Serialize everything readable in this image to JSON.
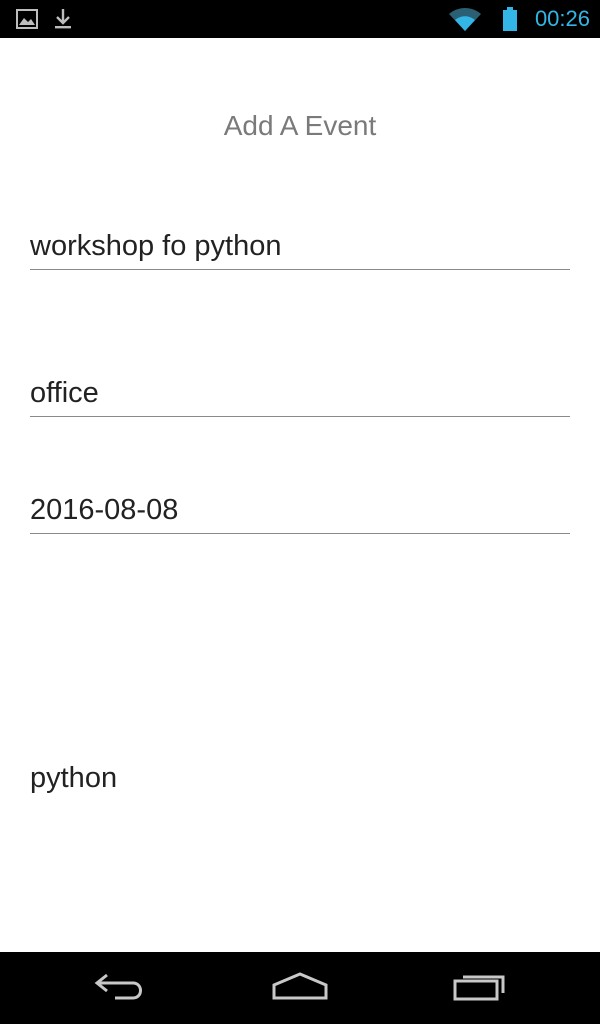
{
  "status_bar": {
    "time": "00:26",
    "icons": [
      "gallery-icon",
      "download-icon",
      "wifi-icon",
      "battery-icon"
    ],
    "clock_color": "#33b5e5"
  },
  "form": {
    "title": "Add A Event",
    "event_name_value": "workshop fo python",
    "location_value": "office",
    "date_value": "2016-08-08",
    "tag_text": "python"
  },
  "nav_bar": {
    "buttons": [
      "back-icon",
      "home-icon",
      "recent-apps-icon"
    ]
  }
}
